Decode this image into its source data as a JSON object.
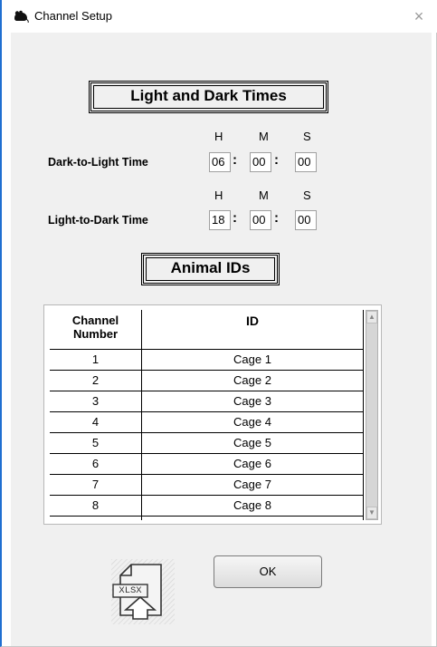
{
  "window": {
    "title": "Channel Setup",
    "close_glyph": "×"
  },
  "sections": {
    "light_dark_title": "Light and Dark Times",
    "animal_ids_title": "Animal IDs"
  },
  "hms_labels": {
    "h": "H",
    "m": "M",
    "s": "S"
  },
  "dark_to_light": {
    "label": "Dark-to-Light Time",
    "h": "06",
    "m": "00",
    "s": "00"
  },
  "light_to_dark": {
    "label": "Light-to-Dark Time",
    "h": "18",
    "m": "00",
    "s": "00"
  },
  "table": {
    "headers": {
      "channel": "Channel Number",
      "id": "ID"
    },
    "rows": [
      {
        "channel": "1",
        "id": "Cage 1"
      },
      {
        "channel": "2",
        "id": "Cage 2"
      },
      {
        "channel": "3",
        "id": "Cage 3"
      },
      {
        "channel": "4",
        "id": "Cage 4"
      },
      {
        "channel": "5",
        "id": "Cage 5"
      },
      {
        "channel": "6",
        "id": "Cage 6"
      },
      {
        "channel": "7",
        "id": "Cage 7"
      },
      {
        "channel": "8",
        "id": "Cage 8"
      }
    ]
  },
  "buttons": {
    "xlsx_label": "XLSX",
    "ok_label": "OK"
  },
  "icons": {
    "app": "mouse-icon",
    "close": "close-icon",
    "xlsx": "xlsx-import-icon",
    "scroll_up": "scroll-up-arrow-icon",
    "scroll_down": "scroll-down-arrow-icon"
  }
}
